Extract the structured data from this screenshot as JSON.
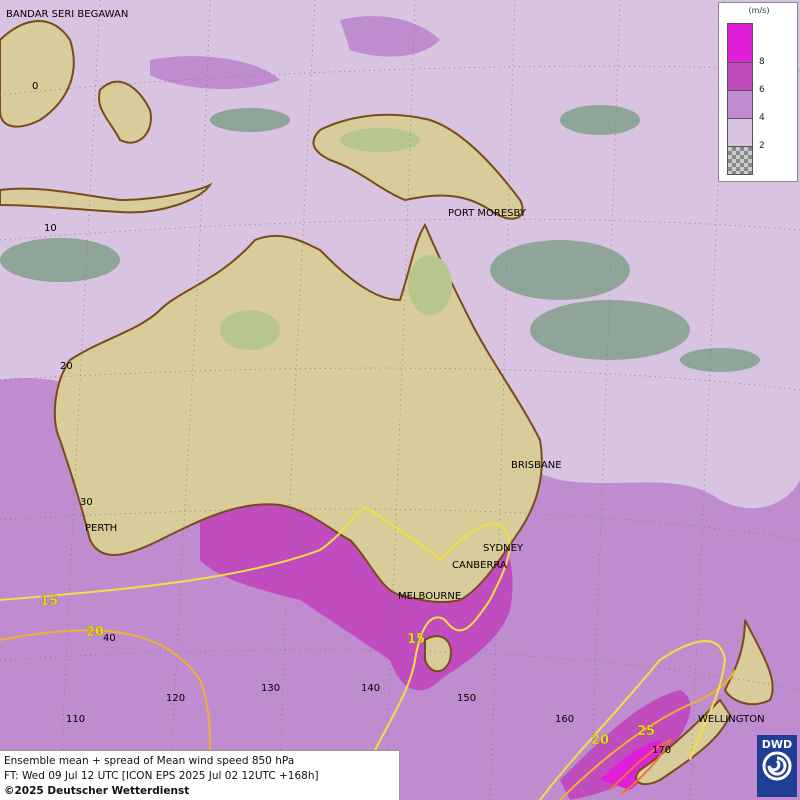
{
  "map": {
    "title_line1": "Ensemble mean + spread of Mean wind speed 850 hPa",
    "title_line2": "FT: Wed 09 Jul 12 UTC [ICON EPS 2025 Jul 02 12UTC +168h]",
    "copyright": "©2025 Deutscher Wetterdienst",
    "logo_text": "DWD"
  },
  "legend": {
    "unit": "(m/s)",
    "ticks": [
      "8",
      "6",
      "4",
      "2"
    ],
    "colors": {
      "gt8": "#e020d8",
      "6_8": "#c04cc0",
      "4_6": "#c08cd0",
      "2_4": "#d8c4e0",
      "lt2": "checker"
    }
  },
  "places": {
    "bandar": "BANDAR SERI BEGAWAN",
    "port_moresby": "PORT MORESBY",
    "brisbane": "BRISBANE",
    "perth": "PERTH",
    "sydney": "SYDNEY",
    "canberra": "CANBERRA",
    "melbourne": "MELBOURNE",
    "wellington": "WELLINGTON"
  },
  "grid": {
    "lat_0": "0",
    "lat_10": "10",
    "lat_20": "20",
    "lat_30": "30",
    "lat_40": "40",
    "lon_110": "110",
    "lon_120": "120",
    "lon_130": "130",
    "lon_140": "140",
    "lon_150": "150",
    "lon_160": "160",
    "lon_170": "170"
  },
  "contours": {
    "c15a": "15",
    "c15b": "15",
    "c20a": "20",
    "c20b": "20",
    "c25": "25"
  },
  "colors": {
    "land": "#d8cc9a",
    "land_green": "#9ab08c",
    "low_spread": "#8fa59a",
    "coast": "#7a4a1a",
    "contour15": "#f0e040",
    "contour20": "#f0b030"
  }
}
